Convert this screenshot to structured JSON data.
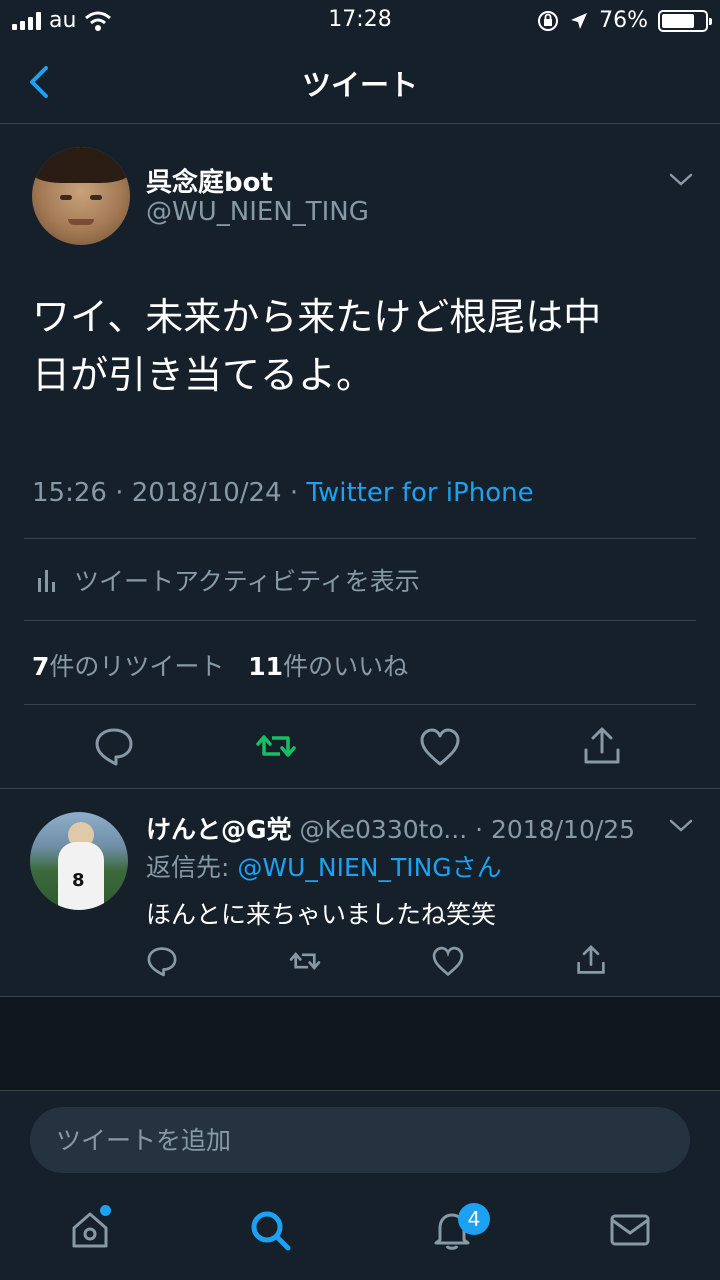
{
  "status_bar": {
    "carrier": "au",
    "time": "17:28",
    "battery": "76%",
    "battery_level": 0.76
  },
  "header": {
    "title": "ツイート"
  },
  "tweet": {
    "author_name": "呉念庭bot",
    "author_handle": "@WU_NIEN_TING",
    "text_line1": "ワイ、未来から来たけど根尾は中",
    "text_line2": "日が引き当てるよ。",
    "time": "15:26",
    "date": "2018/10/24",
    "source": "Twitter for iPhone",
    "activity_label": "ツイートアクティビティを表示",
    "retweet_count": "7",
    "retweet_label": "件のリツイート",
    "like_count": "11",
    "like_label": "件のいいね"
  },
  "reply": {
    "author_name": "けんと@G党",
    "author_handle": "@Ke0330to...",
    "date": "2018/10/25",
    "reply_to_prefix": "返信先: ",
    "reply_to_handle": "@WU_NIEN_TINGさん",
    "text": "ほんとに来ちゃいましたね笑笑",
    "avatar_jersey_text": "8"
  },
  "compose": {
    "placeholder": "ツイートを追加"
  },
  "tabbar": {
    "notification_count": "4"
  },
  "colors": {
    "background": "#15202b",
    "accent": "#1da1f2",
    "retweet_green": "#17bf63",
    "secondary_text": "#8899a6"
  }
}
